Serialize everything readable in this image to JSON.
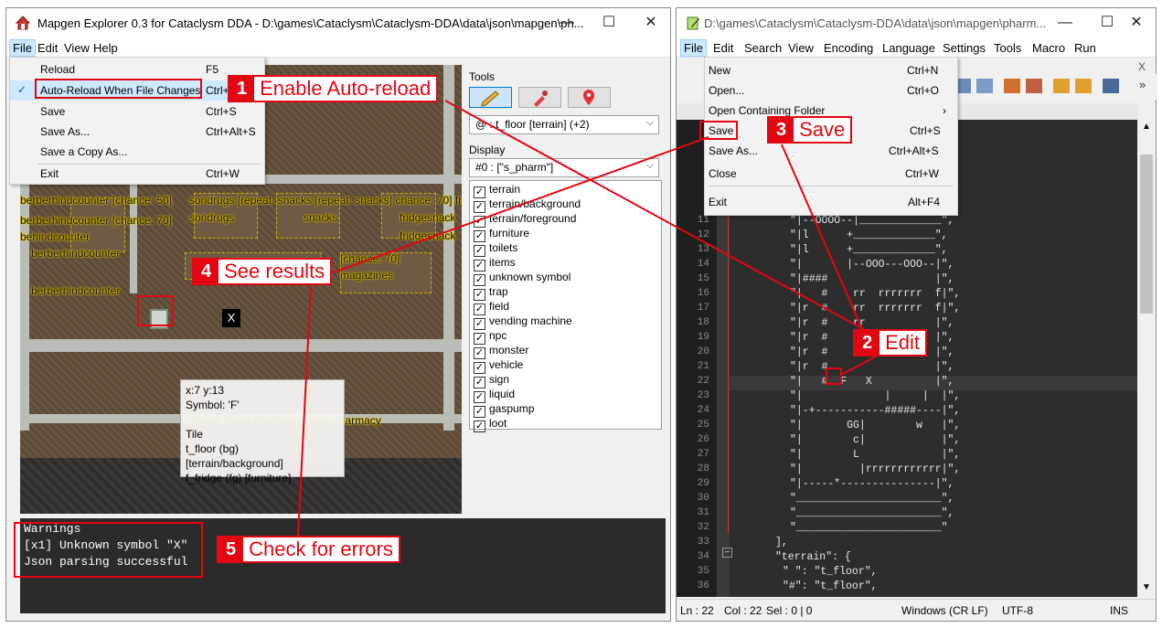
{
  "left_window": {
    "title": "Mapgen Explorer 0.3 for Cataclysm DDA - D:\\games\\Cataclysm\\Cataclysm-DDA\\data\\json\\mapgen\\ph...",
    "controls": {
      "minimize": "—",
      "maximize": "☐",
      "close": "✕"
    },
    "menu": [
      "File",
      "Edit",
      "View",
      "Help"
    ],
    "file_menu": [
      {
        "label": "Reload",
        "shortcut": "F5"
      },
      {
        "label": "Auto-Reload When File Changes",
        "shortcut": "Ctrl+",
        "checked": true
      },
      {
        "label": "Save",
        "shortcut": "Ctrl+S"
      },
      {
        "label": "Save As...",
        "shortcut": "Ctrl+Alt+S"
      },
      {
        "label": "Save a Copy As...",
        "shortcut": ""
      },
      {
        "label": "Exit",
        "shortcut": "Ctrl+W"
      }
    ],
    "map_labels": [
      "berberhindcounter [chance: 50]",
      "sondrugs [repeat: snacks [repeat: snacks] chance: 70] fridges",
      "berberhindcounter [chance: 70]",
      "sondrugs",
      "snacks",
      "fridgesnack",
      "behindcounter",
      "fridgesnack",
      "berberhindcounter",
      "magazines",
      "berberhindcounter",
      "dvdmagazines",
      "[chance: 70]",
      "/dugs /dugs-pharmacy/dugs-pharmacy"
    ],
    "tooltip": {
      "coords": "x:7 y:13",
      "symbol": "Symbol: 'F'",
      "heading": "Tile",
      "bg": "t_floor (bg) [terrain/background]",
      "fg": "f_fridge (fg) [furniture]"
    },
    "tools": {
      "heading": "Tools",
      "buttons": [
        "pencil-icon",
        "eyedropper-icon",
        "location-pin-icon"
      ],
      "selected_brush": "@ : t_floor [terrain] (+2)"
    },
    "display": {
      "heading": "Display",
      "selected": "#0 : [\"s_pharm\"]",
      "layers": [
        "terrain",
        "terrain/background",
        "terrain/foreground",
        "furniture",
        "toilets",
        "items",
        "unknown symbol",
        "trap",
        "field",
        "vending machine",
        "npc",
        "monster",
        "vehicle",
        "sign",
        "liquid",
        "gaspump",
        "loot"
      ]
    },
    "warnings": {
      "lines": [
        "Warnings",
        "[x1] Unknown symbol \"X\"",
        "Json parsing successful"
      ]
    },
    "marker_x": "X"
  },
  "right_window": {
    "title": "D:\\games\\Cataclysm\\Cataclysm-DDA\\data\\json\\mapgen\\pharm...",
    "controls": {
      "minimize": "—",
      "maximize": "☐",
      "close": "✕"
    },
    "menu": [
      "File",
      "Edit",
      "Search",
      "View",
      "Encoding",
      "Language",
      "Settings",
      "Tools",
      "Macro",
      "Run"
    ],
    "menu_close_x": "X",
    "file_menu": [
      {
        "label": "New",
        "shortcut": "Ctrl+N"
      },
      {
        "label": "Open...",
        "shortcut": "Ctrl+O"
      },
      {
        "label": "Open Containing Folder",
        "shortcut": "›"
      },
      {
        "label": "Save",
        "shortcut": "Ctrl+S"
      },
      {
        "label": "Save As...",
        "shortcut": "Ctrl+Alt+S"
      },
      {
        "label": "Close",
        "shortcut": "Ctrl+W"
      },
      {
        "label": "Exit",
        "shortcut": "Alt+F4"
      }
    ],
    "lines": [
      {
        "n": "11",
        "t": "\"|--OOOO--|_____________\","
      },
      {
        "n": "12",
        "t": "\"|l      +_____________\","
      },
      {
        "n": "13",
        "t": "\"|l      +_____________\","
      },
      {
        "n": "14",
        "t": "\"|       |--OOO---OOO--|\","
      },
      {
        "n": "15",
        "t": "\"|####                 |\","
      },
      {
        "n": "16",
        "t": "\"|   #    rr  rrrrrrr  f|\","
      },
      {
        "n": "17",
        "t": "\"|r  #    rr  rrrrrrr  f|\","
      },
      {
        "n": "18",
        "t": "\"|r  #    rr           |\","
      },
      {
        "n": "19",
        "t": "\"|r  #    rr           |\","
      },
      {
        "n": "20",
        "t": "\"|r  #    rr           |\","
      },
      {
        "n": "21",
        "t": "\"|r  #                 |\","
      },
      {
        "n": "22",
        "t": "\"|   #  F   X          |\","
      },
      {
        "n": "23",
        "t": "\"|             |     |  |\","
      },
      {
        "n": "24",
        "t": "\"|-+-----------#####----|\","
      },
      {
        "n": "25",
        "t": "\"|       GG|        w   |\","
      },
      {
        "n": "26",
        "t": "\"|        c|            |\","
      },
      {
        "n": "27",
        "t": "\"|        L             |\","
      },
      {
        "n": "28",
        "t": "\"|         |rrrrrrrrrrrr|\","
      },
      {
        "n": "29",
        "t": "\"|-----*---------------|\","
      },
      {
        "n": "30",
        "t": "\"_______________________\","
      },
      {
        "n": "31",
        "t": "\"_______________________\","
      },
      {
        "n": "32",
        "t": "\"_______________________\""
      },
      {
        "n": "33",
        "t": "],"
      },
      {
        "n": "34",
        "t": "\"terrain\": {"
      },
      {
        "n": "35",
        "t": "\" \": \"t_floor\","
      },
      {
        "n": "36",
        "t": "\"#\": \"t_floor\","
      }
    ],
    "status": {
      "ln": "Ln : 22",
      "col": "Col : 22",
      "sel": "Sel : 0 | 0",
      "eol": "Windows (CR LF)",
      "encoding": "UTF-8",
      "mode": "INS"
    }
  },
  "callouts": [
    {
      "num": "1",
      "text": "Enable Auto-reload"
    },
    {
      "num": "2",
      "text": "Edit"
    },
    {
      "num": "3",
      "text": "Save"
    },
    {
      "num": "4",
      "text": "See results"
    },
    {
      "num": "5",
      "text": "Check for errors"
    }
  ],
  "colors": {
    "callout_red": "#e30613",
    "warnings_bg": "#2b2b2b",
    "editor_bg": "#2d2d2d"
  }
}
